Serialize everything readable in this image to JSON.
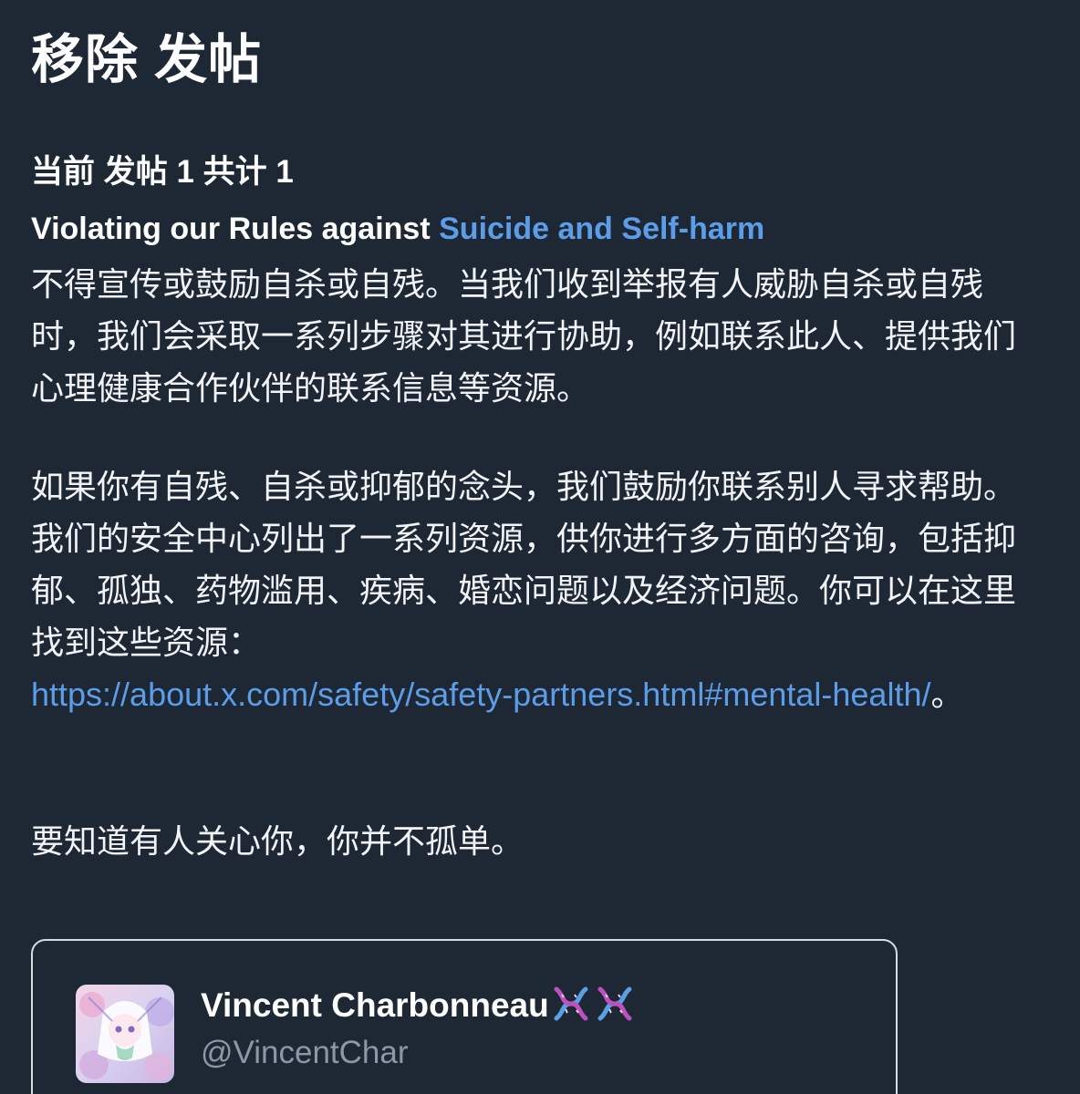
{
  "header": {
    "title": "移除 发帖"
  },
  "notice": {
    "counter": "当前 发帖 1 共计 1",
    "violation_prefix": "Violating our Rules against ",
    "violation_link": "Suicide and Self-harm",
    "paragraph1": "不得宣传或鼓励自杀或自残。当我们收到举报有人威胁自杀或自残时，我们会采取一系列步骤对其进行协助，例如联系此人、提供我们心理健康合作伙伴的联系信息等资源。",
    "paragraph2": "如果你有自残、自杀或抑郁的念头，我们鼓励你联系别人寻求帮助。我们的安全中心列出了一系列资源，供你进行多方面的咨询，包括抑郁、孤独、药物滥用、疾病、婚恋问题以及经济问题。你可以在这里找到这些资源：",
    "resource_url": "https://about.x.com/safety/safety-partners.html#mental-health/",
    "url_suffix": "。",
    "paragraph3": "要知道有人关心你，你并不孤单。"
  },
  "post_card": {
    "author_name": "Vincent Charbonneau",
    "author_badges": [
      "dna-icon",
      "dna-icon"
    ],
    "author_handle": "@VincentChar"
  },
  "colors": {
    "background": "#1e2734",
    "link": "#5c9de8",
    "handle": "#8b98a5",
    "card_border": "#d7dbe0"
  }
}
